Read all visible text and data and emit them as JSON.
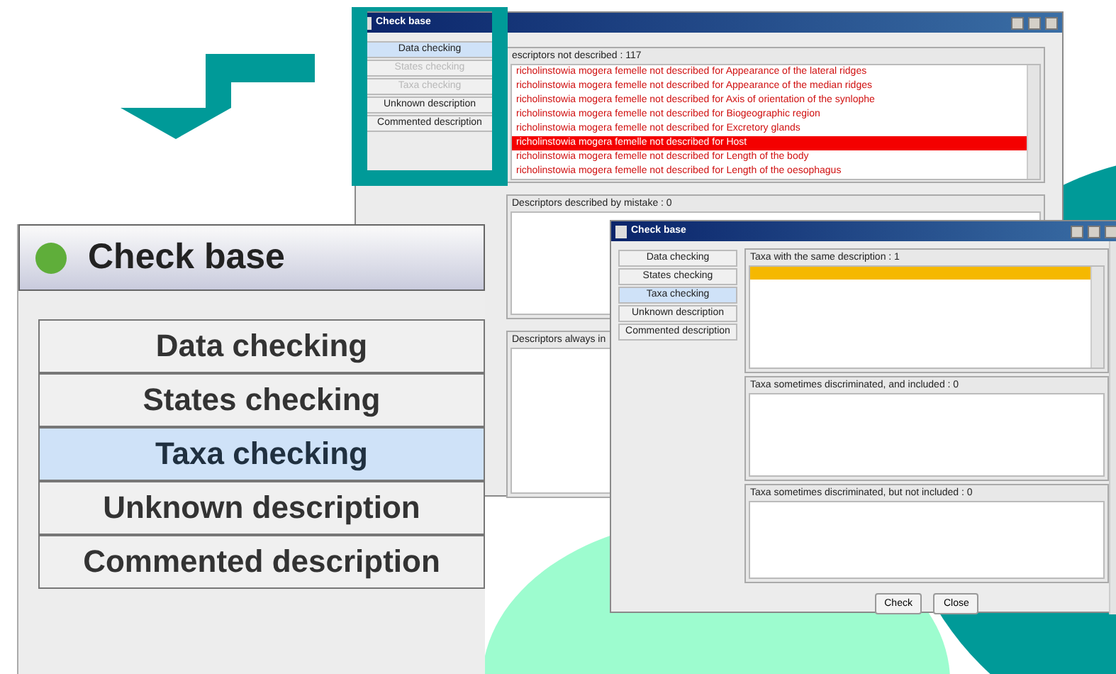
{
  "main_window": {
    "title": "Check base",
    "nav": [
      {
        "label": "Data checking",
        "selected": true,
        "disabled": false
      },
      {
        "label": "States checking",
        "selected": false,
        "disabled": true
      },
      {
        "label": "Taxa checking",
        "selected": false,
        "disabled": true
      },
      {
        "label": "Unknown description",
        "selected": false,
        "disabled": false
      },
      {
        "label": "Commented description",
        "selected": false,
        "disabled": false
      }
    ],
    "sections": [
      {
        "title": "escriptors not described : 117",
        "rows": [
          {
            "text": "richolinstowia mogera femelle not described for Appearance of the lateral ridges",
            "selected": false
          },
          {
            "text": "richolinstowia mogera femelle not described for Appearance of the median ridges",
            "selected": false
          },
          {
            "text": "richolinstowia mogera femelle not described for Axis of orientation of the synlophe",
            "selected": false
          },
          {
            "text": "richolinstowia mogera femelle not described for Biogeographic region",
            "selected": false
          },
          {
            "text": "richolinstowia mogera femelle not described for Excretory glands",
            "selected": false
          },
          {
            "text": "richolinstowia mogera femelle not described for Host",
            "selected": true
          },
          {
            "text": "richolinstowia mogera femelle not described for Length of the body",
            "selected": false
          },
          {
            "text": "richolinstowia mogera femelle not described for Length of the oesophagus",
            "selected": false
          }
        ]
      },
      {
        "title": "Descriptors described by mistake : 0"
      },
      {
        "title": "Descriptors always in"
      }
    ]
  },
  "zoomed_panel": {
    "title": "Check base",
    "nav": [
      {
        "label": "Data checking",
        "selected": false
      },
      {
        "label": "States checking",
        "selected": false
      },
      {
        "label": "Taxa checking",
        "selected": true
      },
      {
        "label": "Unknown description",
        "selected": false
      },
      {
        "label": "Commented description",
        "selected": false
      }
    ]
  },
  "second_window": {
    "title": "Check base",
    "nav": [
      {
        "label": "Data checking",
        "selected": false,
        "disabled": false
      },
      {
        "label": "States checking",
        "selected": false,
        "disabled": false
      },
      {
        "label": "Taxa checking",
        "selected": true,
        "disabled": false
      },
      {
        "label": "Unknown description",
        "selected": false,
        "disabled": false
      },
      {
        "label": "Commented description",
        "selected": false,
        "disabled": false
      }
    ],
    "sections": [
      {
        "title": "Taxa with the same description : 1",
        "rows": [
          {
            "selected": true
          }
        ]
      },
      {
        "title": "Taxa sometimes discriminated, and included : 0"
      },
      {
        "title": "Taxa sometimes discriminated, but not included : 0"
      }
    ],
    "buttons": [
      "Check",
      "Close"
    ]
  }
}
